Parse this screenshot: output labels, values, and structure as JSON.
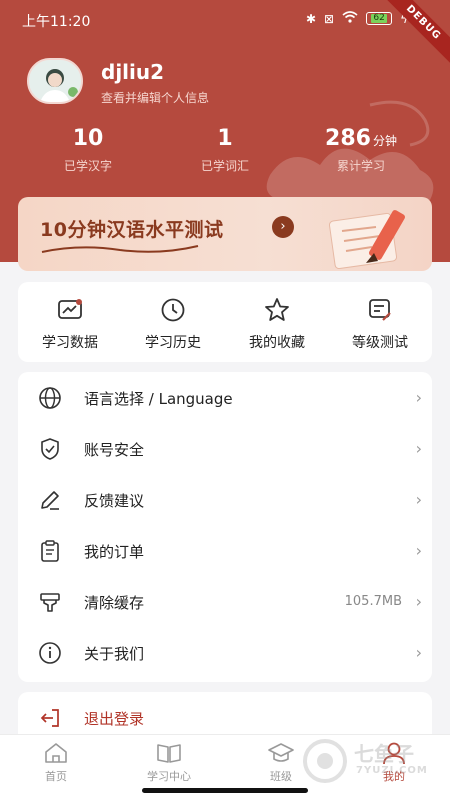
{
  "status_bar": {
    "time": "上午11:20",
    "battery": "62"
  },
  "debug_banner": "DEBUG",
  "profile": {
    "username": "djliu2",
    "subtitle": "查看并编辑个人信息"
  },
  "stats": [
    {
      "value": "10",
      "unit": "",
      "label": "已学汉字"
    },
    {
      "value": "1",
      "unit": "",
      "label": "已学词汇"
    },
    {
      "value": "286",
      "unit": "分钟",
      "label": "累计学习"
    }
  ],
  "test_banner": {
    "title": "10分钟汉语水平测试",
    "arrow": "›"
  },
  "quick_actions": [
    {
      "label": "学习数据",
      "icon": "chart-icon"
    },
    {
      "label": "学习历史",
      "icon": "clock-icon"
    },
    {
      "label": "我的收藏",
      "icon": "star-icon"
    },
    {
      "label": "等级测试",
      "icon": "test-icon"
    }
  ],
  "menu": [
    {
      "label": "语言选择 / Language",
      "icon": "globe-icon",
      "value": ""
    },
    {
      "label": "账号安全",
      "icon": "shield-icon",
      "value": ""
    },
    {
      "label": "反馈建议",
      "icon": "pen-icon",
      "value": ""
    },
    {
      "label": "我的订单",
      "icon": "clipboard-icon",
      "value": ""
    },
    {
      "label": "清除缓存",
      "icon": "brush-icon",
      "value": "105.7MB"
    },
    {
      "label": "关于我们",
      "icon": "info-icon",
      "value": ""
    }
  ],
  "logout": {
    "label": "退出登录",
    "icon": "logout-icon"
  },
  "tabs": [
    {
      "label": "首页",
      "icon": "home-icon",
      "active": false
    },
    {
      "label": "学习中心",
      "icon": "book-icon",
      "active": false
    },
    {
      "label": "班级",
      "icon": "graduation-cap-icon",
      "active": false
    },
    {
      "label": "我的",
      "icon": "user-icon",
      "active": true
    }
  ],
  "watermark": {
    "main": "七鱼子",
    "sub": "7YUZI.COM"
  },
  "colors": {
    "brand": "#b54a3e",
    "logout": "#b13428",
    "banner_text": "#8a3a1f"
  }
}
